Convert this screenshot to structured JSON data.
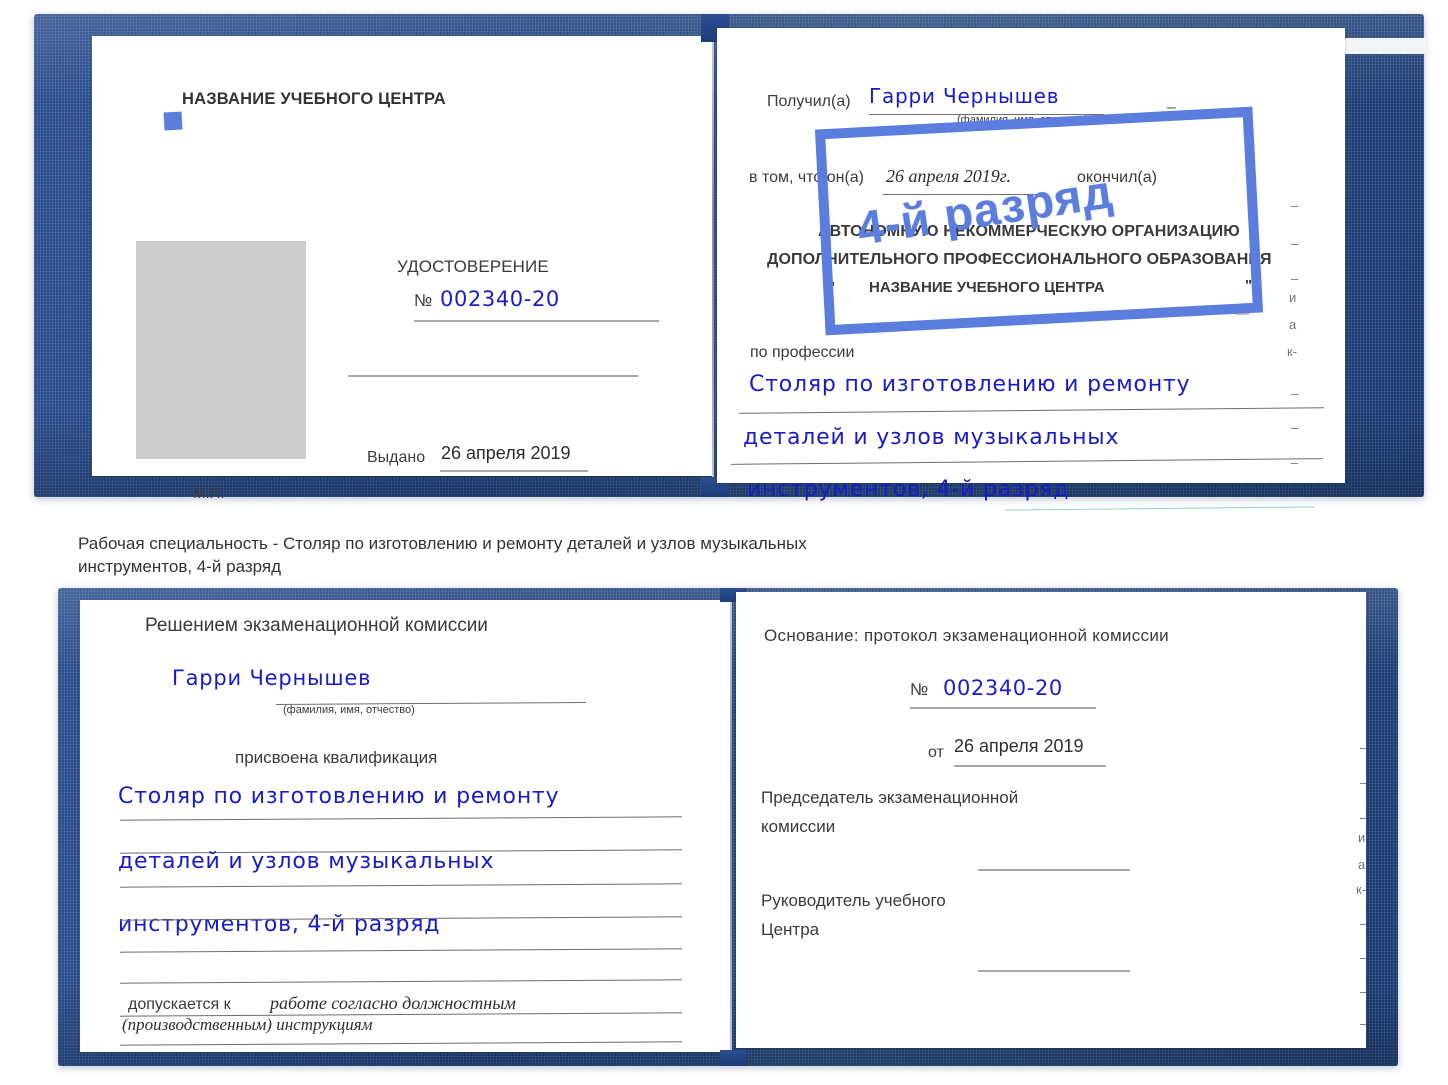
{
  "document": {
    "type": "Удостоверение (certificate booklet)",
    "number": "002340-20",
    "issue_date": "26 апреля 2019",
    "holder_name": "Гарри Чернышев",
    "grade_stamp": "4-й разряд",
    "colors": {
      "cover_blue": "#1e3f7d",
      "ink_blue": "#1c1cc8",
      "stamp_blue": "#5b7ede",
      "photo_gray": "#cccccc",
      "page_white": "#ffffff"
    }
  },
  "top_booklet": {
    "left_page": {
      "title": "НАЗВАНИЕ УЧЕБНОГО ЦЕНТРА",
      "doc_word": "УДОСТОВЕРЕНИЕ",
      "number_prefix": "№",
      "number_value": "002340-20",
      "issued_label": "Выдано",
      "issued_value": "26 апреля 2019",
      "seal_label": "М.П.",
      "photo_placeholder": "photo"
    },
    "right_page": {
      "received_label": "Получил(а)",
      "received_value": "Гарри Чернышев",
      "fio_hint": "(фамилия, имя, отчество)",
      "that_he_label": "в том, что он(а)",
      "finish_date": "26 апреля 2019г.",
      "finished_label": "окончил(а)",
      "org_line1": "АВТОНОМНУЮ НЕКОММЕРЧЕСКУЮ ОРГАНИЗАЦИЮ",
      "org_line2": "ДОПОЛНИТЕЛЬНОГО ПРОФЕССИОНАЛЬНОГО ОБРАЗОВАНИЯ",
      "org_quote_open": "\"",
      "org_name": "НАЗВАНИЕ УЧЕБНОГО ЦЕНТРА",
      "org_quote_close": "\"",
      "profession_label": "по профессии",
      "profession_line1": "Столяр по изготовлению и ремонту",
      "profession_line2": "деталей и узлов музыкальных",
      "profession_line3": "инструментов, 4-й разряд",
      "stamp_text": "4-й разряд",
      "bleed_marks": [
        "–",
        "–",
        "–",
        "и",
        "а",
        "к-"
      ]
    }
  },
  "caption": {
    "line1": "Рабочая специальность - Столяр по изготовлению и ремонту деталей и узлов музыкальных",
    "line2": "инструментов, 4-й разряд"
  },
  "bottom_booklet": {
    "left_page": {
      "title": "Решением экзаменационной комиссии",
      "name_value": "Гарри Чернышев",
      "fio_hint": "(фамилия, имя, отчество)",
      "qualification_label": "присвоена квалификация",
      "qual_line1": "Столяр по изготовлению и ремонту",
      "qual_line2": "деталей и узлов музыкальных",
      "qual_line3": "инструментов, 4-й разряд",
      "admitted_label": "допускается к",
      "admitted_value_line1": "работе согласно должностным",
      "admitted_value_line2": "(производственным) инструкциям"
    },
    "right_page": {
      "basis_label": "Основание: протокол экзаменационной комиссии",
      "number_prefix": "№",
      "number_value": "002340-20",
      "from_label": "от",
      "from_value": "26 апреля 2019",
      "chairman_line1": "Председатель экзаменационной",
      "chairman_line2": "комиссии",
      "head_line1": "Руководитель учебного",
      "head_line2": "Центра",
      "bleed_marks": [
        "–",
        "–",
        "–",
        "и",
        "а",
        "к-",
        "–",
        "–",
        "–",
        "–"
      ]
    }
  }
}
